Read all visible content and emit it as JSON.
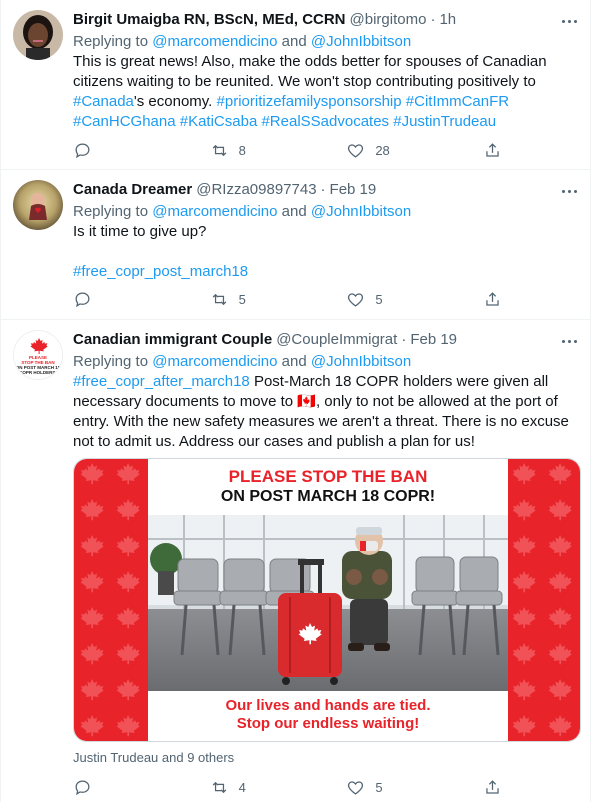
{
  "tweets": [
    {
      "name": "Birgit Umaigba RN, BScN, MEd, CCRN",
      "handle": "@birgitomo",
      "time": "1h",
      "replying_prefix": "Replying to ",
      "mention1": "@marcomendicino",
      "and": " and ",
      "mention2": "@JohnIbbitson",
      "text_a": "This is great news! Also, make the odds better for spouses of Canadian citizens waiting to be reunited. We won't stop contributing positively to ",
      "tag_canada": "#Canada",
      "text_b": "'s economy. ",
      "tag_prio": "#prioritizefamilysponsorship",
      "tag_citimm": "#CitImmCanFR",
      "tag_canhc": "#CanHCGhana",
      "tag_kati": "#KatiCsaba",
      "tag_reals": "#RealSSadvocates",
      "tag_jt": "#JustinTrudeau",
      "reply_count": "",
      "retweet_count": "8",
      "like_count": "28"
    },
    {
      "name": "Canada Dreamer",
      "handle": "@RIzza09897743",
      "time": "Feb 19",
      "replying_prefix": "Replying to ",
      "mention1": "@marcomendicino",
      "and": " and ",
      "mention2": "@JohnIbbitson",
      "text": "Is it time to give up?",
      "tag": "#free_copr_post_march18",
      "reply_count": "",
      "retweet_count": "5",
      "like_count": "5"
    },
    {
      "name": "Canadian immigrant Couple",
      "handle": "@CoupleImmigrat",
      "time": "Feb 19",
      "replying_prefix": "Replying to ",
      "mention1": "@marcomendicino",
      "and": " and ",
      "mention2": "@JohnIbbitson",
      "tag": "#free_copr_after_march18",
      "text_a": " Post-March 18 COPR holders were given all necessary documents to move to ",
      "flag": "🇨🇦",
      "text_b": ", only to not be allowed at the port of entry. With the new safety measures we aren't a threat. There is no excuse not to admit us. Address our cases and publish a plan for us!",
      "image_title1": "PLEASE STOP THE BAN",
      "image_title2": "ON POST MARCH 18 COPR!",
      "image_caption1": "Our lives and hands are tied.",
      "image_caption2": "Stop our endless waiting!",
      "avatar_text1": "PLEASE",
      "avatar_text2": "STOP THE BAN",
      "avatar_text3": "ON POST MARCH 18",
      "avatar_text4": "COPR HOLDERS!",
      "social_context": "Justin Trudeau and 9 others",
      "reply_count": "",
      "retweet_count": "4",
      "like_count": "5"
    }
  ],
  "colors": {
    "accent": "#1d9bf0",
    "secondary_text": "#536471",
    "canada_red": "#e8232a"
  },
  "icons": [
    "reply-icon",
    "retweet-icon",
    "like-icon",
    "share-icon",
    "more-icon"
  ]
}
